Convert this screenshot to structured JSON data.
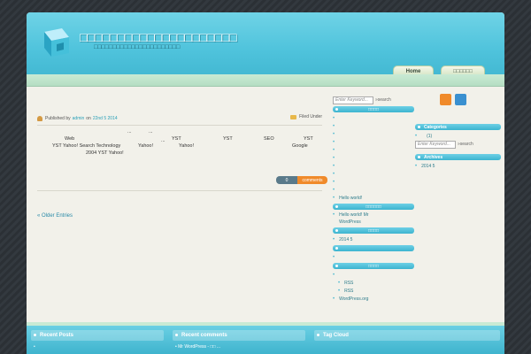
{
  "header": {
    "site_title": "□□□□□□□□□□□□□□□□□□□□□",
    "site_description": "□□□□□□□□□□□□□□□□□□□□□□□"
  },
  "nav": {
    "home_label": "Home",
    "other_label": "□□□□□□"
  },
  "post": {
    "published_by": "Published by",
    "author": "admin",
    "on_label": "on",
    "date": "22nd 5  2014",
    "filed_under": "Filed Under",
    "body_line1": [
      "Web",
      "...",
      "...",
      "YST",
      "YST",
      "SEO",
      "YST"
    ],
    "body_line2": [
      "YST Yahoo! Search Technology",
      "Yahoo!",
      "Yahoo!",
      "Google"
    ],
    "body_line3": [
      "2004  YST  Yahoo!"
    ],
    "extra_dots": "...",
    "comments_count": "0",
    "comments_label": "comments"
  },
  "older_entries": "« Older Entries",
  "sidebar1": {
    "search_placeholder": "Enter Keyword...",
    "search_button": "»search",
    "widget1_title": "□□□□",
    "recent_post": "Hello world!",
    "widget2_title": "□□□□□□",
    "recent_comment": "Hello world!  Mr WordPress",
    "widget3_title": "□□□□",
    "archive_item": "2014 5",
    "widget4_title": "□□□□",
    "meta_items": [
      "RSS",
      "RSS",
      "WordPress.org"
    ]
  },
  "sidebar2": {
    "categories_title": "Categories",
    "category_count": "(1)",
    "search_placeholder": "Enter Keyword...",
    "search_button": "»search",
    "archives_title": "Archives",
    "archive_item": "2014 5"
  },
  "footer": {
    "recent_posts_title": "Recent Posts",
    "recent_comments_title": "Recent comments",
    "recent_comment_item": "Mr WordPress -       □□ ...",
    "tag_cloud_title": "Tag Cloud"
  },
  "colors": {
    "accent": "#4fc3dc",
    "link": "#2a8aa8",
    "comments_badge": "#f08a2a"
  }
}
